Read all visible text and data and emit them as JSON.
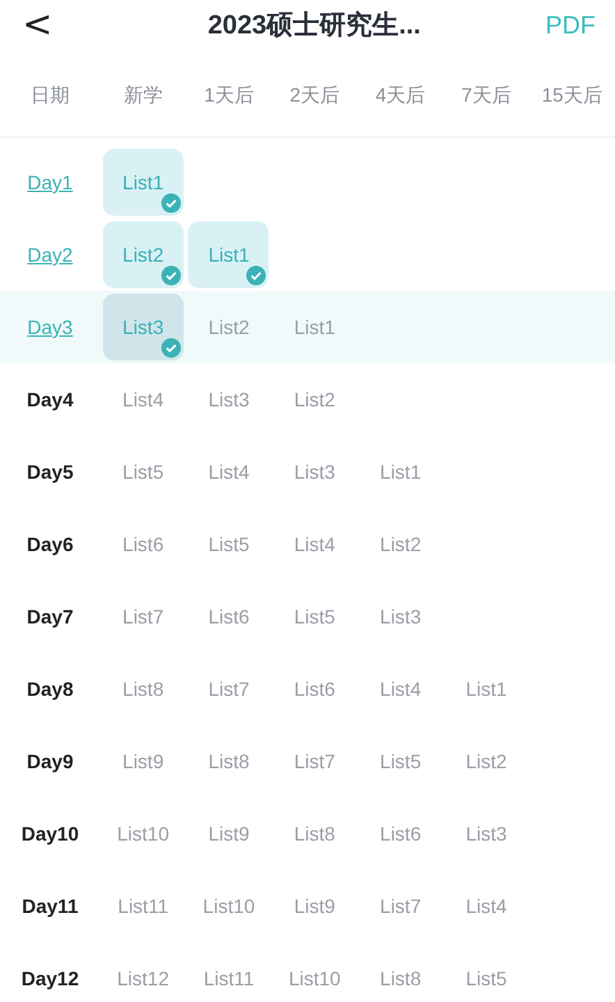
{
  "header": {
    "back": "<",
    "title": "2023硕士研究生...",
    "action": "PDF"
  },
  "columns": [
    "日期",
    "新学",
    "1天后",
    "2天后",
    "4天后",
    "7天后",
    "15天后"
  ],
  "rows": [
    {
      "day": "Day1",
      "linked": true,
      "selected": false,
      "cells": [
        {
          "text": "List1",
          "done": true
        }
      ]
    },
    {
      "day": "Day2",
      "linked": true,
      "selected": false,
      "cells": [
        {
          "text": "List2",
          "done": true
        },
        {
          "text": "List1",
          "done": true
        }
      ]
    },
    {
      "day": "Day3",
      "linked": true,
      "selected": true,
      "cells": [
        {
          "text": "List3",
          "done": true
        },
        {
          "text": "List2",
          "done": false
        },
        {
          "text": "List1",
          "done": false
        }
      ]
    },
    {
      "day": "Day4",
      "linked": false,
      "selected": false,
      "cells": [
        {
          "text": "List4",
          "done": false
        },
        {
          "text": "List3",
          "done": false
        },
        {
          "text": "List2",
          "done": false
        }
      ]
    },
    {
      "day": "Day5",
      "linked": false,
      "selected": false,
      "cells": [
        {
          "text": "List5",
          "done": false
        },
        {
          "text": "List4",
          "done": false
        },
        {
          "text": "List3",
          "done": false
        },
        {
          "text": "List1",
          "done": false
        }
      ]
    },
    {
      "day": "Day6",
      "linked": false,
      "selected": false,
      "cells": [
        {
          "text": "List6",
          "done": false
        },
        {
          "text": "List5",
          "done": false
        },
        {
          "text": "List4",
          "done": false
        },
        {
          "text": "List2",
          "done": false
        }
      ]
    },
    {
      "day": "Day7",
      "linked": false,
      "selected": false,
      "cells": [
        {
          "text": "List7",
          "done": false
        },
        {
          "text": "List6",
          "done": false
        },
        {
          "text": "List5",
          "done": false
        },
        {
          "text": "List3",
          "done": false
        }
      ]
    },
    {
      "day": "Day8",
      "linked": false,
      "selected": false,
      "cells": [
        {
          "text": "List8",
          "done": false
        },
        {
          "text": "List7",
          "done": false
        },
        {
          "text": "List6",
          "done": false
        },
        {
          "text": "List4",
          "done": false
        },
        {
          "text": "List1",
          "done": false
        }
      ]
    },
    {
      "day": "Day9",
      "linked": false,
      "selected": false,
      "cells": [
        {
          "text": "List9",
          "done": false
        },
        {
          "text": "List8",
          "done": false
        },
        {
          "text": "List7",
          "done": false
        },
        {
          "text": "List5",
          "done": false
        },
        {
          "text": "List2",
          "done": false
        }
      ]
    },
    {
      "day": "Day10",
      "linked": false,
      "selected": false,
      "cells": [
        {
          "text": "List10",
          "done": false
        },
        {
          "text": "List9",
          "done": false
        },
        {
          "text": "List8",
          "done": false
        },
        {
          "text": "List6",
          "done": false
        },
        {
          "text": "List3",
          "done": false
        }
      ]
    },
    {
      "day": "Day11",
      "linked": false,
      "selected": false,
      "cells": [
        {
          "text": "List11",
          "done": false
        },
        {
          "text": "List10",
          "done": false
        },
        {
          "text": "List9",
          "done": false
        },
        {
          "text": "List7",
          "done": false
        },
        {
          "text": "List4",
          "done": false
        }
      ]
    },
    {
      "day": "Day12",
      "linked": false,
      "selected": false,
      "cells": [
        {
          "text": "List12",
          "done": false
        },
        {
          "text": "List11",
          "done": false
        },
        {
          "text": "List10",
          "done": false
        },
        {
          "text": "List8",
          "done": false
        },
        {
          "text": "List5",
          "done": false
        }
      ]
    }
  ]
}
